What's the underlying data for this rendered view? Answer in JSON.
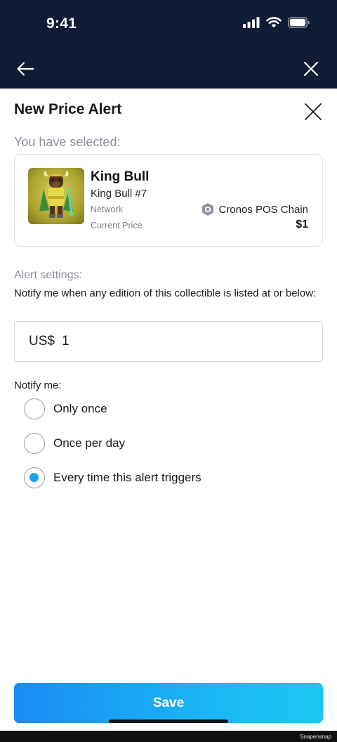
{
  "status_bar": {
    "time": "9:41"
  },
  "sheet": {
    "title": "New Price Alert",
    "selected_label": "You have selected:"
  },
  "collectible": {
    "name": "King Bull",
    "edition": "King Bull #7",
    "network_label": "Network",
    "network_value": "Cronos POS Chain",
    "network_icon": "cronos-hexagon-icon",
    "price_label": "Current Price",
    "price_value": "$1"
  },
  "alert": {
    "label": "Alert settings:",
    "description": "Notify me when any edition of this collectible is listed at or below:",
    "currency": "US$",
    "amount": "1"
  },
  "notify": {
    "label": "Notify me:",
    "options": [
      {
        "label": "Only once",
        "selected": false
      },
      {
        "label": "Once per day",
        "selected": false
      },
      {
        "label": "Every time this alert triggers",
        "selected": true
      }
    ]
  },
  "save_label": "Save",
  "watermark": "Snapensnap",
  "colors": {
    "header_bg": "#101c35",
    "accent": "#1aa4f0",
    "button_gradient_start": "#1a8cf5",
    "button_gradient_end": "#1cc8f2"
  }
}
